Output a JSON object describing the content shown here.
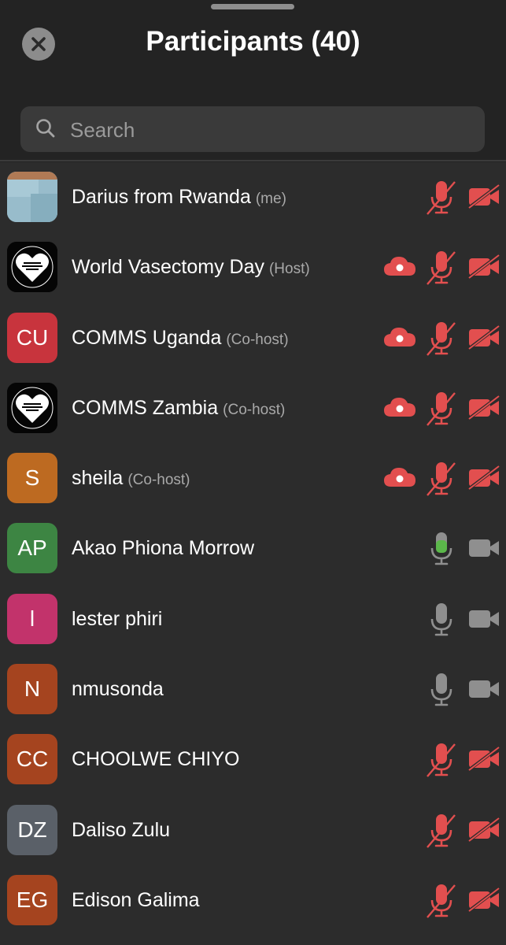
{
  "header": {
    "title": "Participants (40)",
    "search_placeholder": "Search"
  },
  "colors": {
    "muted_red": "#e24f4f",
    "speaking_green": "#5bb84a",
    "idle_gray": "#8f8f8f"
  },
  "participants": [
    {
      "name": "Darius from Rwanda",
      "role": "(me)",
      "avatar_initials": "",
      "avatar_kind": "photo",
      "avatar_color": "#8fb4c4",
      "recording": false,
      "mic": "muted",
      "video": "off"
    },
    {
      "name": "World Vasectomy Day",
      "role": "(Host)",
      "avatar_initials": "",
      "avatar_kind": "logo",
      "avatar_color": "#000000",
      "recording": true,
      "mic": "muted",
      "video": "off"
    },
    {
      "name": "COMMS Uganda",
      "role": "(Co-host)",
      "avatar_initials": "CU",
      "avatar_kind": "initials",
      "avatar_color": "#c8343d",
      "recording": true,
      "mic": "muted",
      "video": "off"
    },
    {
      "name": "COMMS Zambia",
      "role": "(Co-host)",
      "avatar_initials": "",
      "avatar_kind": "logo",
      "avatar_color": "#000000",
      "recording": true,
      "mic": "muted",
      "video": "off"
    },
    {
      "name": "sheila",
      "role": "(Co-host)",
      "avatar_initials": "S",
      "avatar_kind": "initials",
      "avatar_color": "#bd6a21",
      "recording": true,
      "mic": "muted",
      "video": "off"
    },
    {
      "name": "Akao Phiona Morrow",
      "role": "",
      "avatar_initials": "AP",
      "avatar_kind": "initials",
      "avatar_color": "#3d8543",
      "recording": false,
      "mic": "speaking",
      "video": "idle"
    },
    {
      "name": "lester phiri",
      "role": "",
      "avatar_initials": "l",
      "avatar_kind": "initials",
      "avatar_color": "#c2336b",
      "recording": false,
      "mic": "idle",
      "video": "idle"
    },
    {
      "name": "nmusonda",
      "role": "",
      "avatar_initials": "N",
      "avatar_kind": "initials",
      "avatar_color": "#a5441f",
      "recording": false,
      "mic": "idle",
      "video": "idle"
    },
    {
      "name": "CHOOLWE CHIYO",
      "role": "",
      "avatar_initials": "CC",
      "avatar_kind": "initials",
      "avatar_color": "#a5441f",
      "recording": false,
      "mic": "muted",
      "video": "off"
    },
    {
      "name": "Daliso Zulu",
      "role": "",
      "avatar_initials": "DZ",
      "avatar_kind": "initials",
      "avatar_color": "#5a6068",
      "recording": false,
      "mic": "muted",
      "video": "off"
    },
    {
      "name": "Edison Galima",
      "role": "",
      "avatar_initials": "EG",
      "avatar_kind": "initials",
      "avatar_color": "#a5441f",
      "recording": false,
      "mic": "muted",
      "video": "off"
    }
  ]
}
